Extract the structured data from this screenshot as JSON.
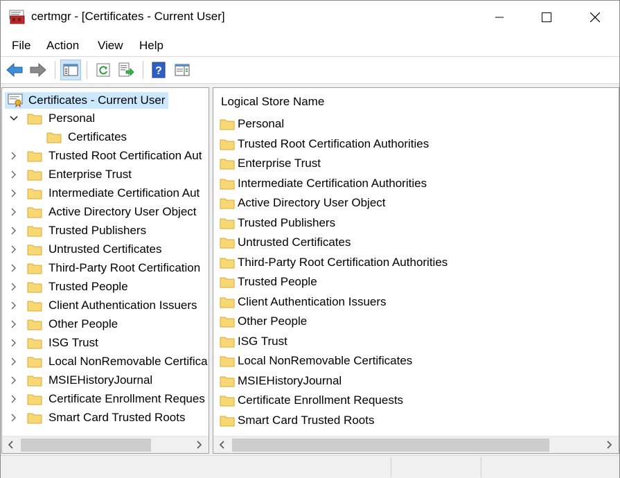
{
  "window": {
    "title": "certmgr - [Certificates - Current User]"
  },
  "menu": [
    "File",
    "Action",
    "View",
    "Help"
  ],
  "toolbar": {
    "buttons": [
      "back-icon",
      "forward-icon",
      "show-hide-console-tree-icon",
      "refresh-icon",
      "export-list-icon",
      "help-icon",
      "action-pane-icon"
    ]
  },
  "tree": {
    "root": "Certificates - Current User",
    "personal": "Personal",
    "personal_child": "Certificates",
    "items": [
      "Trusted Root Certification Aut",
      "Enterprise Trust",
      "Intermediate Certification Aut",
      "Active Directory User Object",
      "Trusted Publishers",
      "Untrusted Certificates",
      "Third-Party Root Certification",
      "Trusted People",
      "Client Authentication Issuers",
      "Other People",
      "ISG Trust",
      "Local NonRemovable Certifica",
      "MSIEHistoryJournal",
      "Certificate Enrollment Reques",
      "Smart Card Trusted Roots"
    ]
  },
  "list": {
    "column_header": "Logical Store Name",
    "rows": [
      "Personal",
      "Trusted Root Certification Authorities",
      "Enterprise Trust",
      "Intermediate Certification Authorities",
      "Active Directory User Object",
      "Trusted Publishers",
      "Untrusted Certificates",
      "Third-Party Root Certification Authorities",
      "Trusted People",
      "Client Authentication Issuers",
      "Other People",
      "ISG Trust",
      "Local NonRemovable Certificates",
      "MSIEHistoryJournal",
      "Certificate Enrollment Requests",
      "Smart Card Trusted Roots"
    ]
  },
  "colors": {
    "selection": "#cce8ff",
    "folder": "#f8d775",
    "folder_edge": "#d9a933"
  }
}
